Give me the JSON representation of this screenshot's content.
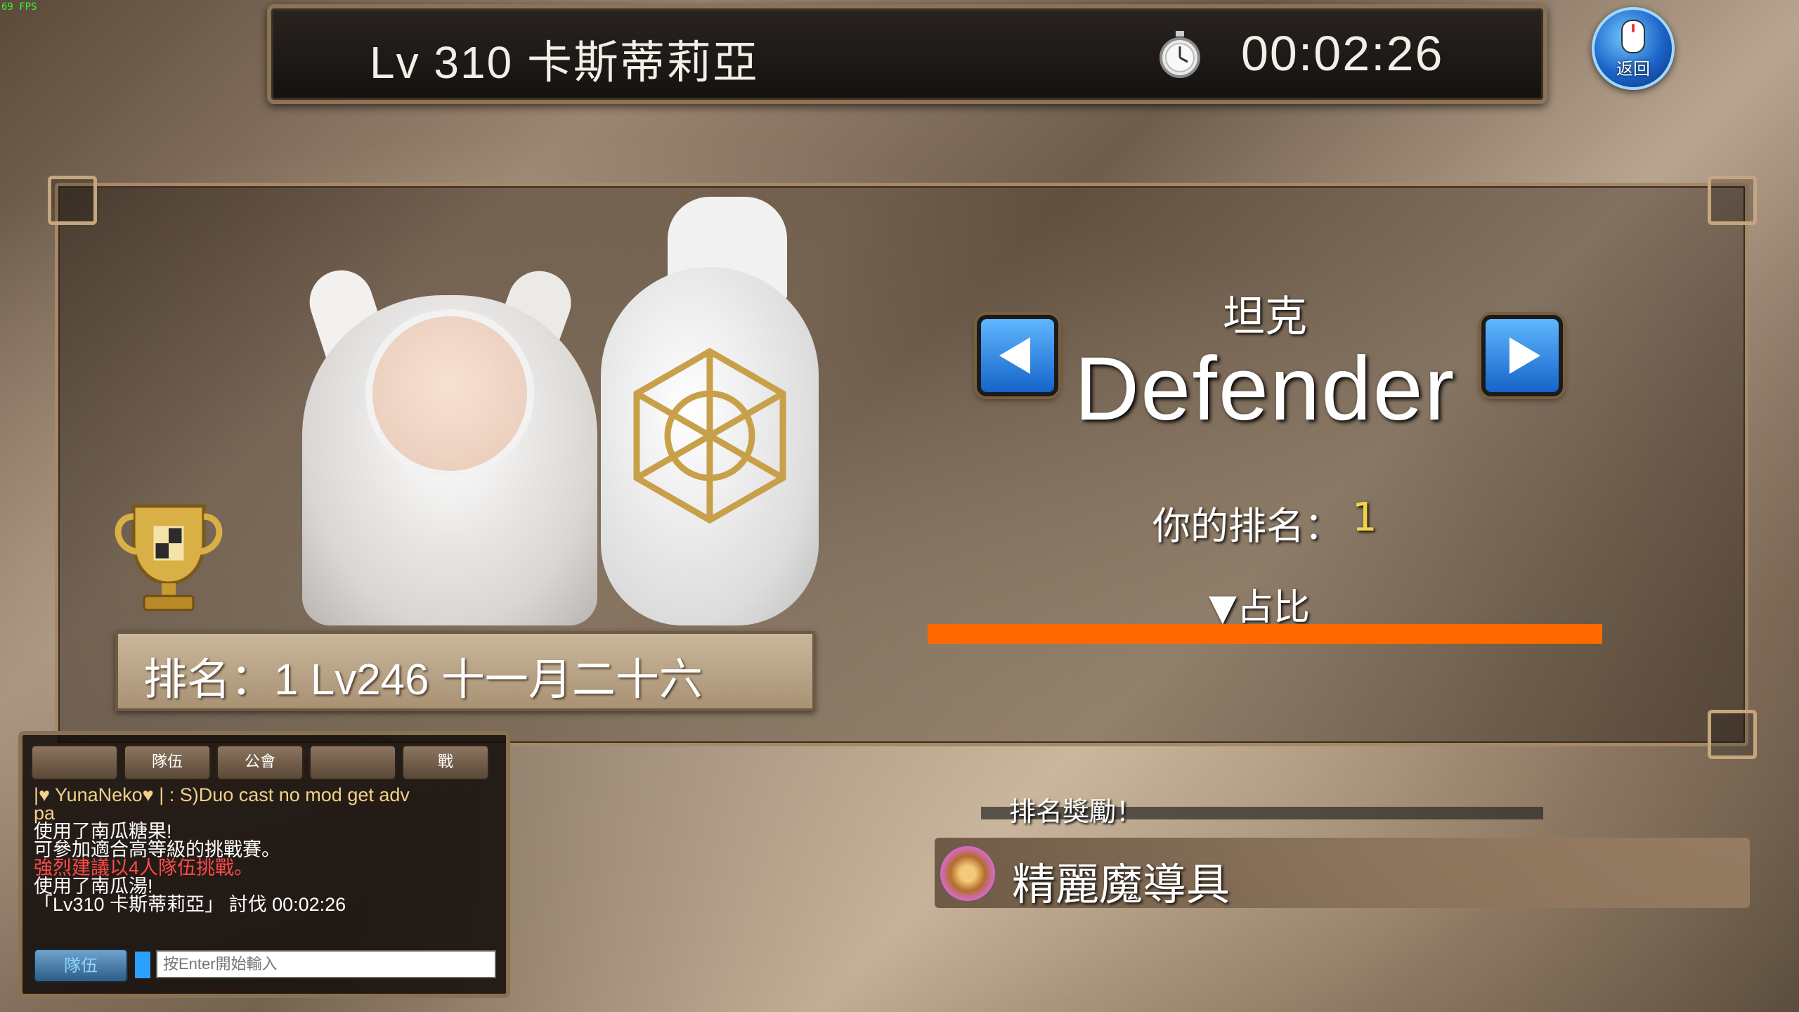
{
  "fps": "69 FPS",
  "top_bar": {
    "level_title": "Lv 310 卡斯蒂莉亞",
    "timer": "00:02:26",
    "timer_icon": "stopwatch-icon"
  },
  "back_button": {
    "label": "返回",
    "icon": "mouse-icon"
  },
  "rank_card": {
    "text": "排名：1 Lv246  十一月二十六",
    "trophy_icon": "trophy-icon"
  },
  "class_selector": {
    "name_cn": "坦克",
    "name_en": "Defender",
    "left_icon": "arrow-left-icon",
    "right_icon": "arrow-right-icon"
  },
  "your_rank": {
    "label": "你的排名：",
    "value": "1"
  },
  "share": {
    "label": "▼占比",
    "fill_fraction": 1.0,
    "color": "#ff6a00"
  },
  "reward": {
    "title": "排名獎勵！",
    "item_name": "精麗魔導具",
    "item_icon": "magic-ring-icon"
  },
  "chat": {
    "tabs": [
      "",
      "隊伍",
      "公會",
      "",
      "戰"
    ],
    "log": [
      {
        "text": "|♥ YunaNeko♥ |   : S)Duo cast no mod get adv",
        "color": "#f3d08a"
      },
      {
        "text": "                                              pa",
        "color": "#f3d08a"
      },
      {
        "text": "使用了南瓜糖果!",
        "color": "#ffffff"
      },
      {
        "text": "可參加適合高等級的挑戰賽。",
        "color": "#ffffff"
      },
      {
        "text": "  強烈建議以4人隊伍挑戰。",
        "color": "#ff4a4a"
      },
      {
        "text": "使用了南瓜湯!",
        "color": "#ffffff"
      },
      {
        "text": "「Lv310 卡斯蒂莉亞」 討伐 00:02:26",
        "color": "#ffffff"
      }
    ],
    "channel_button": "隊伍",
    "input_placeholder": "按Enter開始輸入"
  }
}
